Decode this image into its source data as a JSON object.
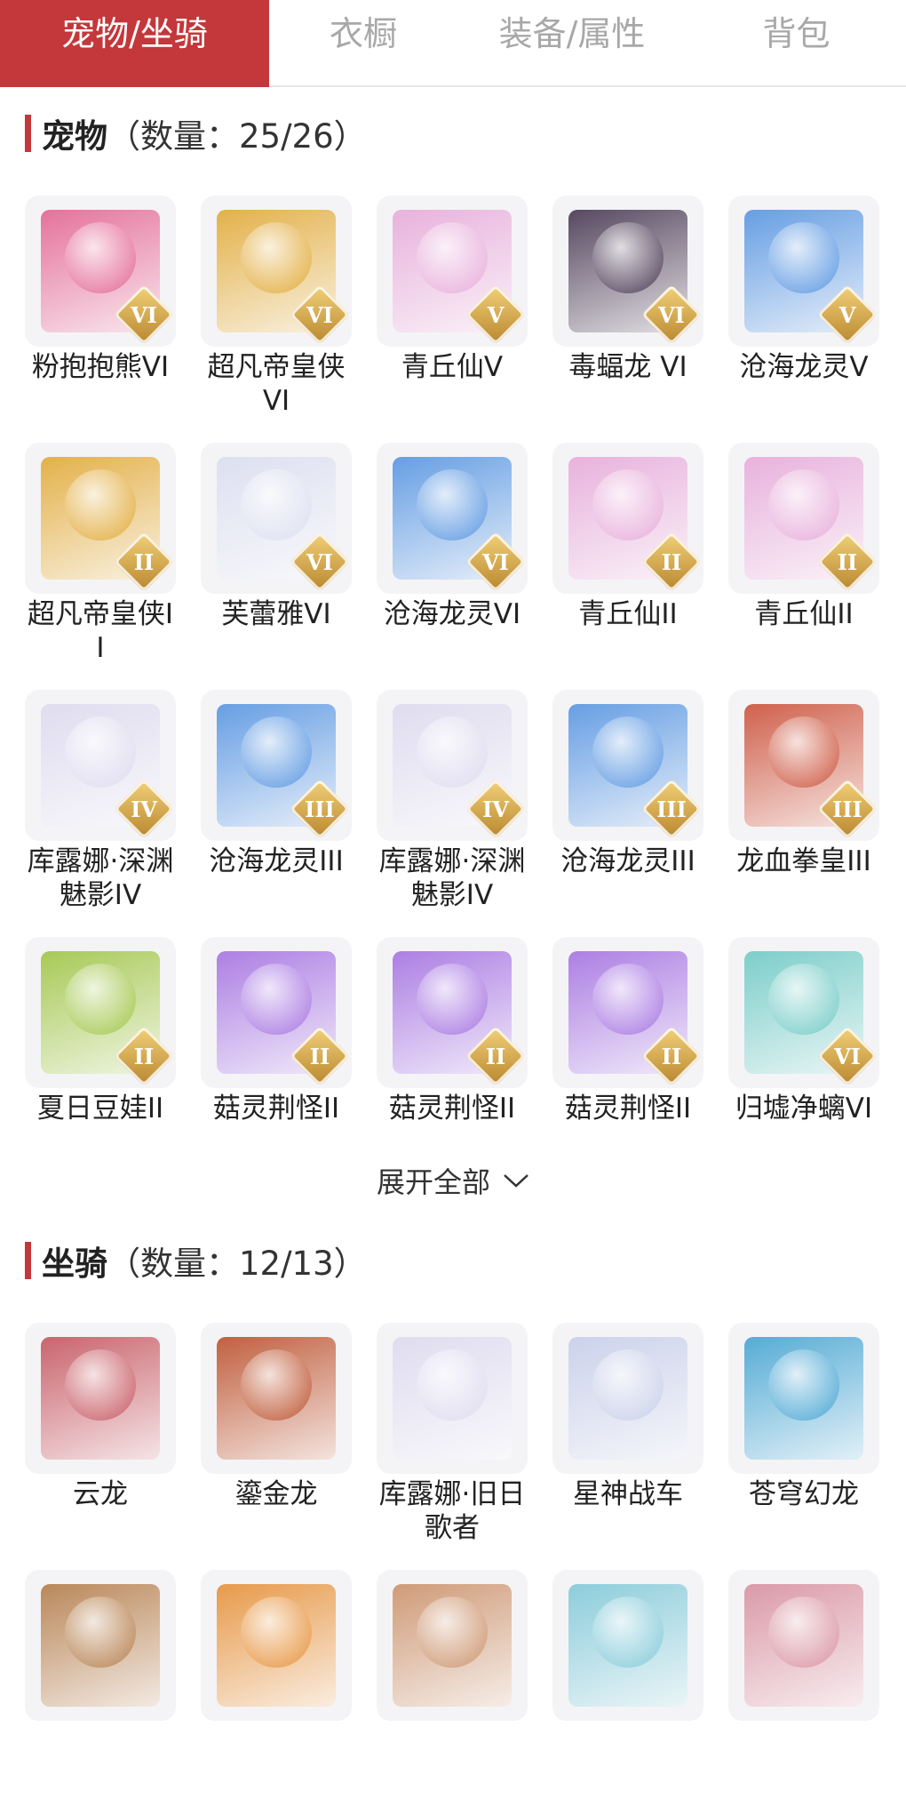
{
  "tabs": [
    "宠物/坐骑",
    "衣橱",
    "装备/属性",
    "背包"
  ],
  "pets": {
    "title": "宠物",
    "count": "（数量：25/26）",
    "items": [
      {
        "name": "粉抱抱熊VI",
        "tier": "VI",
        "color": "#e25b8b"
      },
      {
        "name": "超凡帝皇侠VI",
        "tier": "VI",
        "color": "#e0a52b"
      },
      {
        "name": "青丘仙V",
        "tier": "V",
        "color": "#e6a6d8"
      },
      {
        "name": "毒蝠龙 VI",
        "tier": "VI",
        "color": "#3b2a46"
      },
      {
        "name": "沧海龙灵V",
        "tier": "V",
        "color": "#4d8fe0"
      },
      {
        "name": "超凡帝皇侠II",
        "tier": "II",
        "color": "#e0a52b"
      },
      {
        "name": "芙蕾雅VI",
        "tier": "VI",
        "color": "#d9dcef"
      },
      {
        "name": "沧海龙灵VI",
        "tier": "VI",
        "color": "#4d8fe0"
      },
      {
        "name": "青丘仙II",
        "tier": "II",
        "color": "#e6a6d8"
      },
      {
        "name": "青丘仙II",
        "tier": "II",
        "color": "#e6a6d8"
      },
      {
        "name": "库露娜·深渊魅影IV",
        "tier": "IV",
        "color": "#dcd8ee"
      },
      {
        "name": "沧海龙灵III",
        "tier": "III",
        "color": "#4d8fe0"
      },
      {
        "name": "库露娜·深渊魅影IV",
        "tier": "IV",
        "color": "#dcd8ee"
      },
      {
        "name": "沧海龙灵III",
        "tier": "III",
        "color": "#4d8fe0"
      },
      {
        "name": "龙血拳皇III",
        "tier": "III",
        "color": "#c9472e"
      },
      {
        "name": "夏日豆娃II",
        "tier": "II",
        "color": "#9ac23a"
      },
      {
        "name": "菇灵荆怪II",
        "tier": "II",
        "color": "#a06ae0"
      },
      {
        "name": "菇灵荆怪II",
        "tier": "II",
        "color": "#a06ae0"
      },
      {
        "name": "菇灵荆怪II",
        "tier": "II",
        "color": "#a06ae0"
      },
      {
        "name": "归墟净螭VI",
        "tier": "VI",
        "color": "#67c7c2"
      }
    ]
  },
  "expand_label": "展开全部",
  "mounts": {
    "title": "坐骑",
    "count": "（数量：12/13）",
    "items": [
      {
        "name": "云龙",
        "color": "#c24b55"
      },
      {
        "name": "鎏金龙",
        "color": "#b8461f"
      },
      {
        "name": "库露娜·旧日歌者",
        "color": "#dcd8ee"
      },
      {
        "name": "星神战车",
        "color": "#c4cce8"
      },
      {
        "name": "苍穹幻龙",
        "color": "#3a9fd0"
      },
      {
        "name": "",
        "color": "#b0743e"
      },
      {
        "name": "",
        "color": "#e58a2c"
      },
      {
        "name": "",
        "color": "#c98b62"
      },
      {
        "name": "",
        "color": "#7ac6d6"
      },
      {
        "name": "",
        "color": "#d68a9a"
      }
    ]
  }
}
